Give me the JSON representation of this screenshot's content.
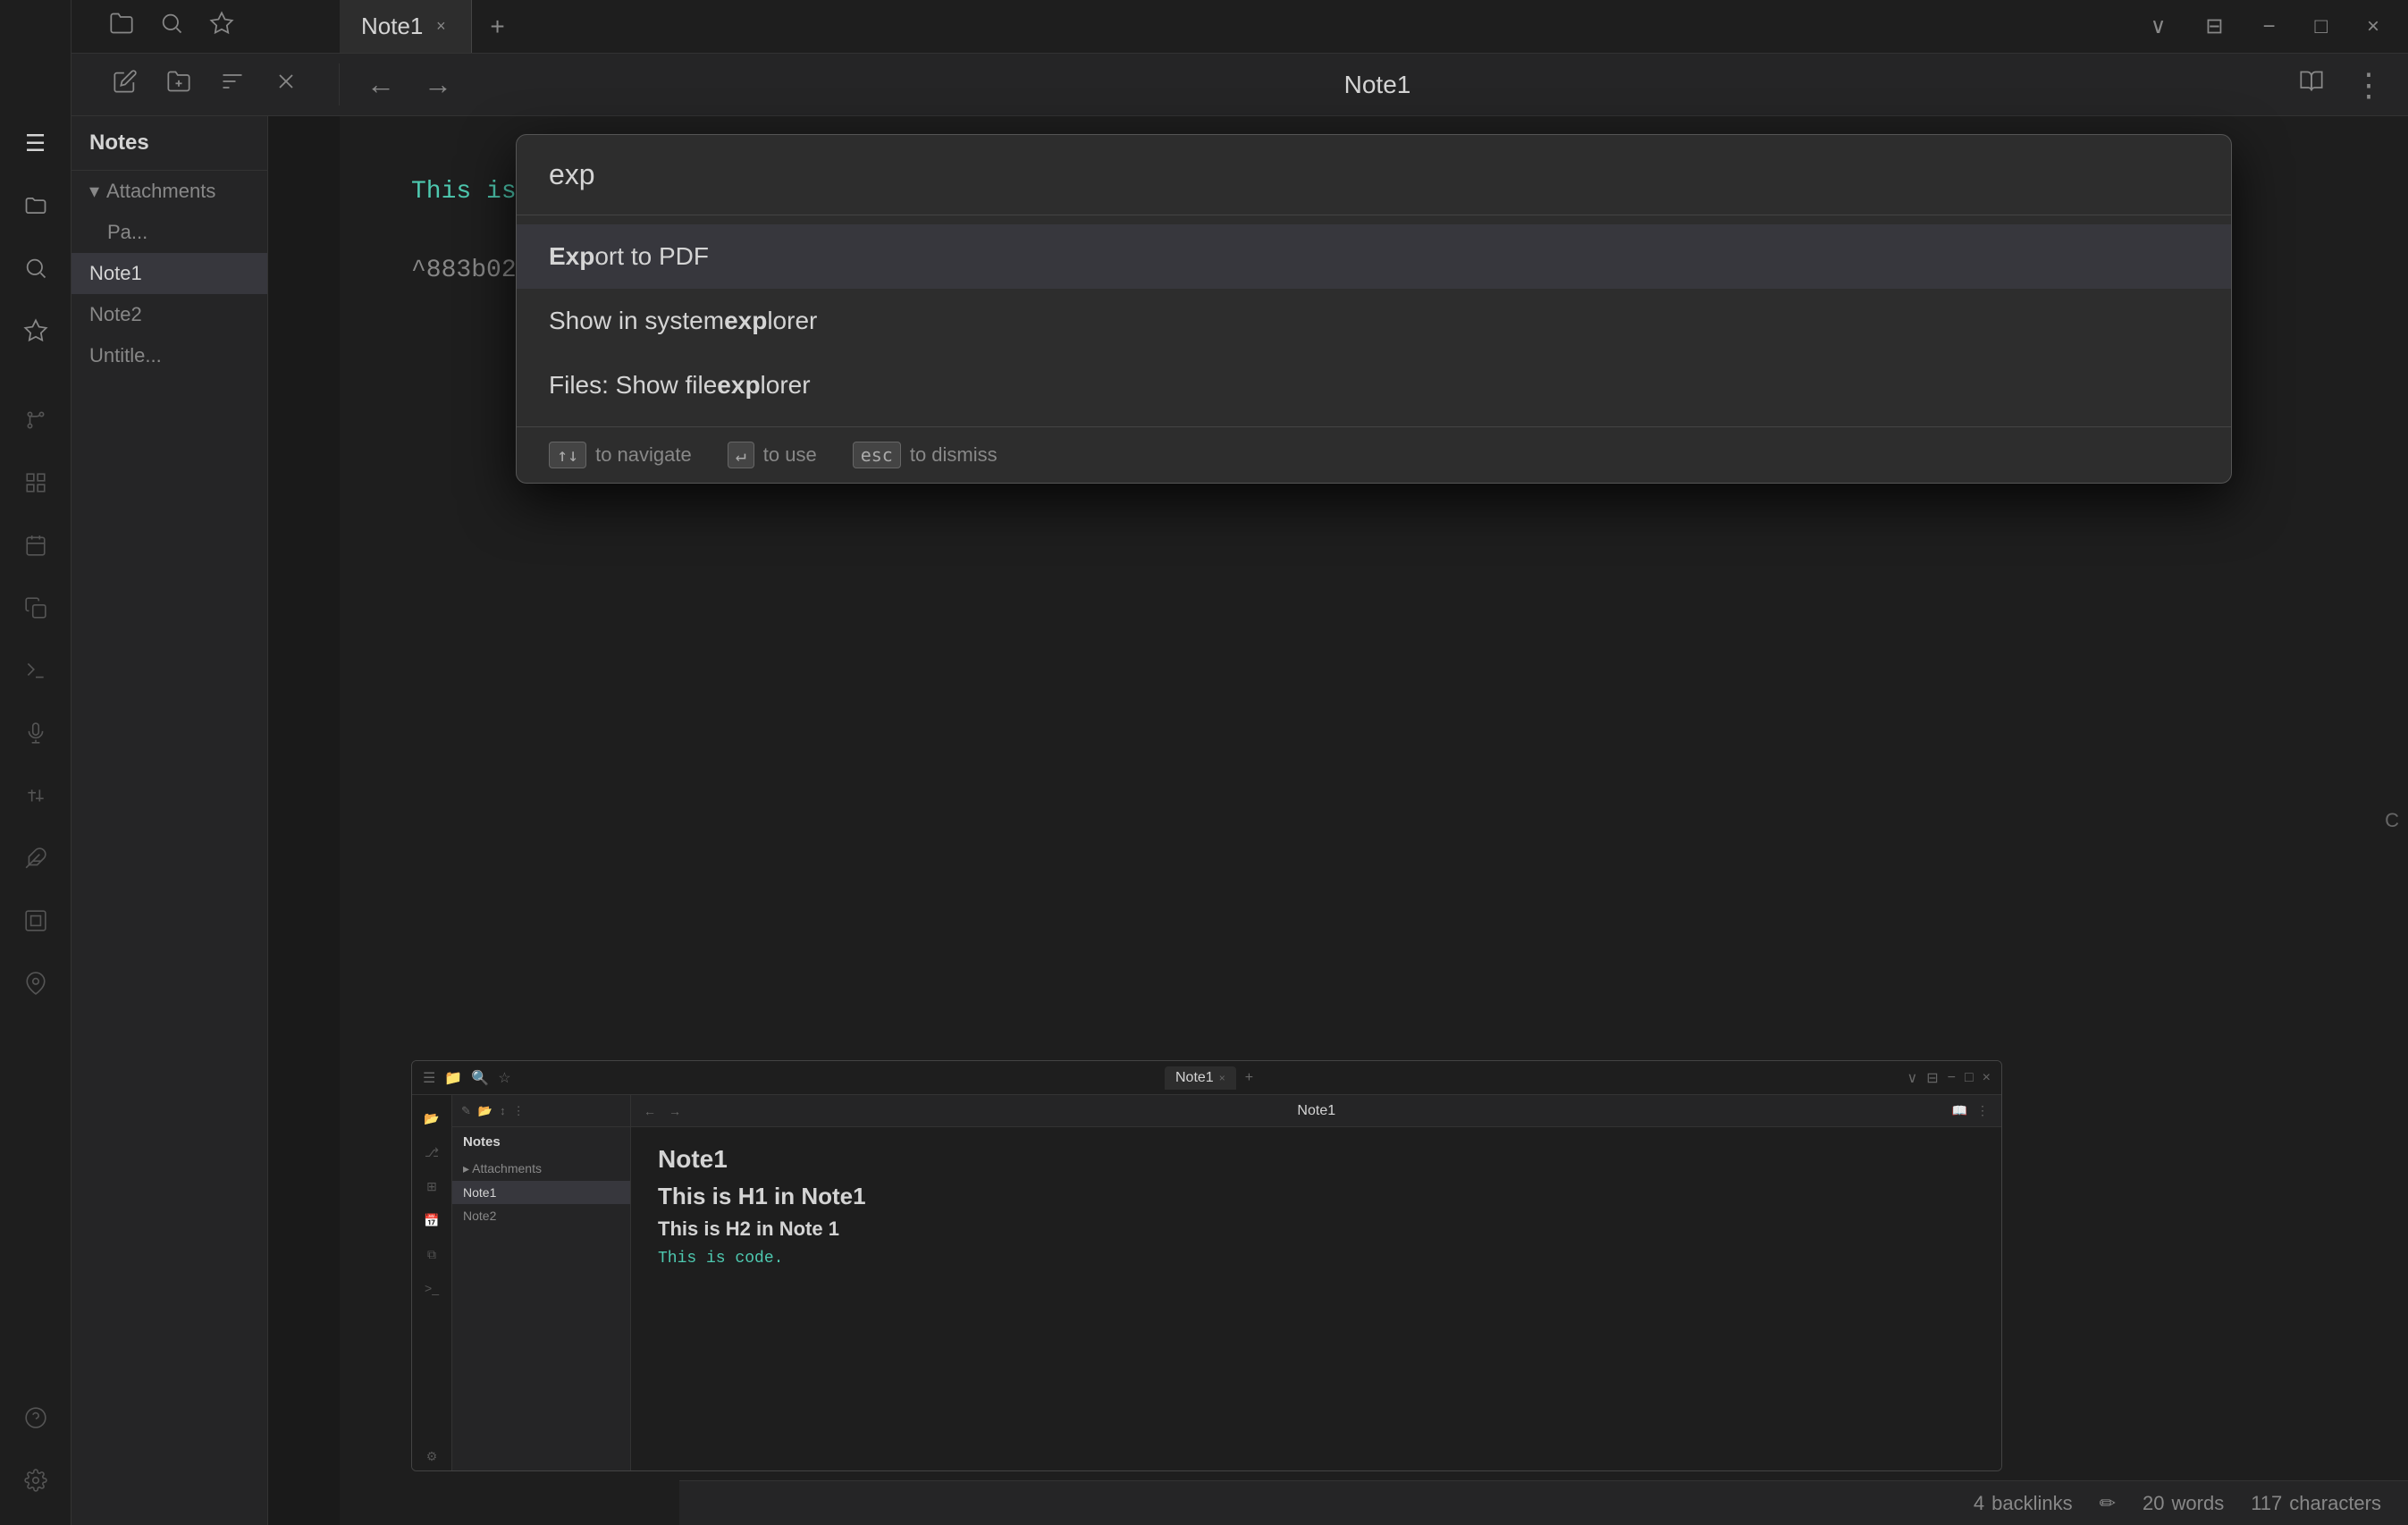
{
  "app": {
    "title": "Note1",
    "tab_label": "Note1",
    "tab_close": "×",
    "tab_new": "+",
    "window_controls": {
      "chevron_down": "∨",
      "split": "⊞",
      "minimize": "−",
      "maximize": "□",
      "close": "×"
    }
  },
  "toolbar": {
    "nav_back": "←",
    "nav_forward": "→",
    "title": "Note1",
    "book_icon": "📖",
    "more_icon": "⋮"
  },
  "sidebar": {
    "icons": [
      {
        "name": "sidebar-toggle-icon",
        "symbol": "☰"
      },
      {
        "name": "folder-icon",
        "symbol": "📁"
      },
      {
        "name": "search-icon",
        "symbol": "🔍"
      },
      {
        "name": "star-icon",
        "symbol": "☆"
      },
      {
        "name": "new-note-icon",
        "symbol": "✎"
      },
      {
        "name": "new-folder-icon",
        "symbol": "📂"
      },
      {
        "name": "sort-icon",
        "symbol": "↕"
      },
      {
        "name": "close-panel-icon",
        "symbol": "×"
      },
      {
        "name": "git-icon",
        "symbol": "⎇"
      },
      {
        "name": "grid-icon",
        "symbol": "⊞"
      },
      {
        "name": "calendar-icon",
        "symbol": "📅"
      },
      {
        "name": "copy-icon",
        "symbol": "⧉"
      },
      {
        "name": "terminal-icon",
        "symbol": ">_"
      },
      {
        "name": "mic-icon",
        "symbol": "🎤"
      },
      {
        "name": "numbers-icon",
        "symbol": "12"
      },
      {
        "name": "puzzle-icon",
        "symbol": "🧩"
      },
      {
        "name": "frame-icon",
        "symbol": "▣"
      },
      {
        "name": "map-icon",
        "symbol": "📍"
      },
      {
        "name": "help-icon",
        "symbol": "?"
      },
      {
        "name": "settings-icon",
        "symbol": "⚙"
      }
    ]
  },
  "file_panel": {
    "header": "Notes",
    "items": [
      {
        "label": "▾ Attachments",
        "type": "group"
      },
      {
        "label": "Pa...",
        "type": "file"
      },
      {
        "label": "Note1",
        "type": "file",
        "active": true
      },
      {
        "label": "Note2",
        "type": "file"
      },
      {
        "label": "Untitle...",
        "type": "file"
      }
    ]
  },
  "note_content": {
    "code_line": "This is code.",
    "hash_ref": "^883b02"
  },
  "command_palette": {
    "input_value": "exp",
    "results": [
      {
        "id": "export-pdf",
        "prefix": "",
        "bold_part": "Exp",
        "suffix": "ort to PDF",
        "highlighted": true
      },
      {
        "id": "show-system-explorer",
        "prefix": "Show in system ",
        "bold_part": "exp",
        "suffix": "lorer",
        "highlighted": false
      },
      {
        "id": "files-show-explorer",
        "prefix": "Files: Show file ",
        "bold_part": "exp",
        "suffix": "lorer",
        "highlighted": false
      }
    ],
    "footer_hints": [
      {
        "keys": "↑↓",
        "label": "to navigate"
      },
      {
        "keys": "↵",
        "label": "to use"
      },
      {
        "keys": "esc",
        "label": "to dismiss"
      }
    ]
  },
  "embedded_note": {
    "tab_label": "Note1",
    "toolbar_title": "Note1",
    "file_header": "Notes",
    "file_items": [
      {
        "label": "▸ Attachments",
        "type": "group"
      },
      {
        "label": "Note1",
        "type": "file",
        "active": true
      },
      {
        "label": "Note2",
        "type": "file"
      }
    ],
    "note_title": "Note1",
    "h1": "This is H1 in Note1",
    "h2": "This is H2 in Note 1",
    "code_line": "This is code."
  },
  "status_bar": {
    "backlinks_count": "4",
    "backlinks_label": "backlinks",
    "edit_icon": "✏",
    "words_count": "20",
    "words_label": "words",
    "chars_count": "117",
    "chars_label": "characters"
  }
}
